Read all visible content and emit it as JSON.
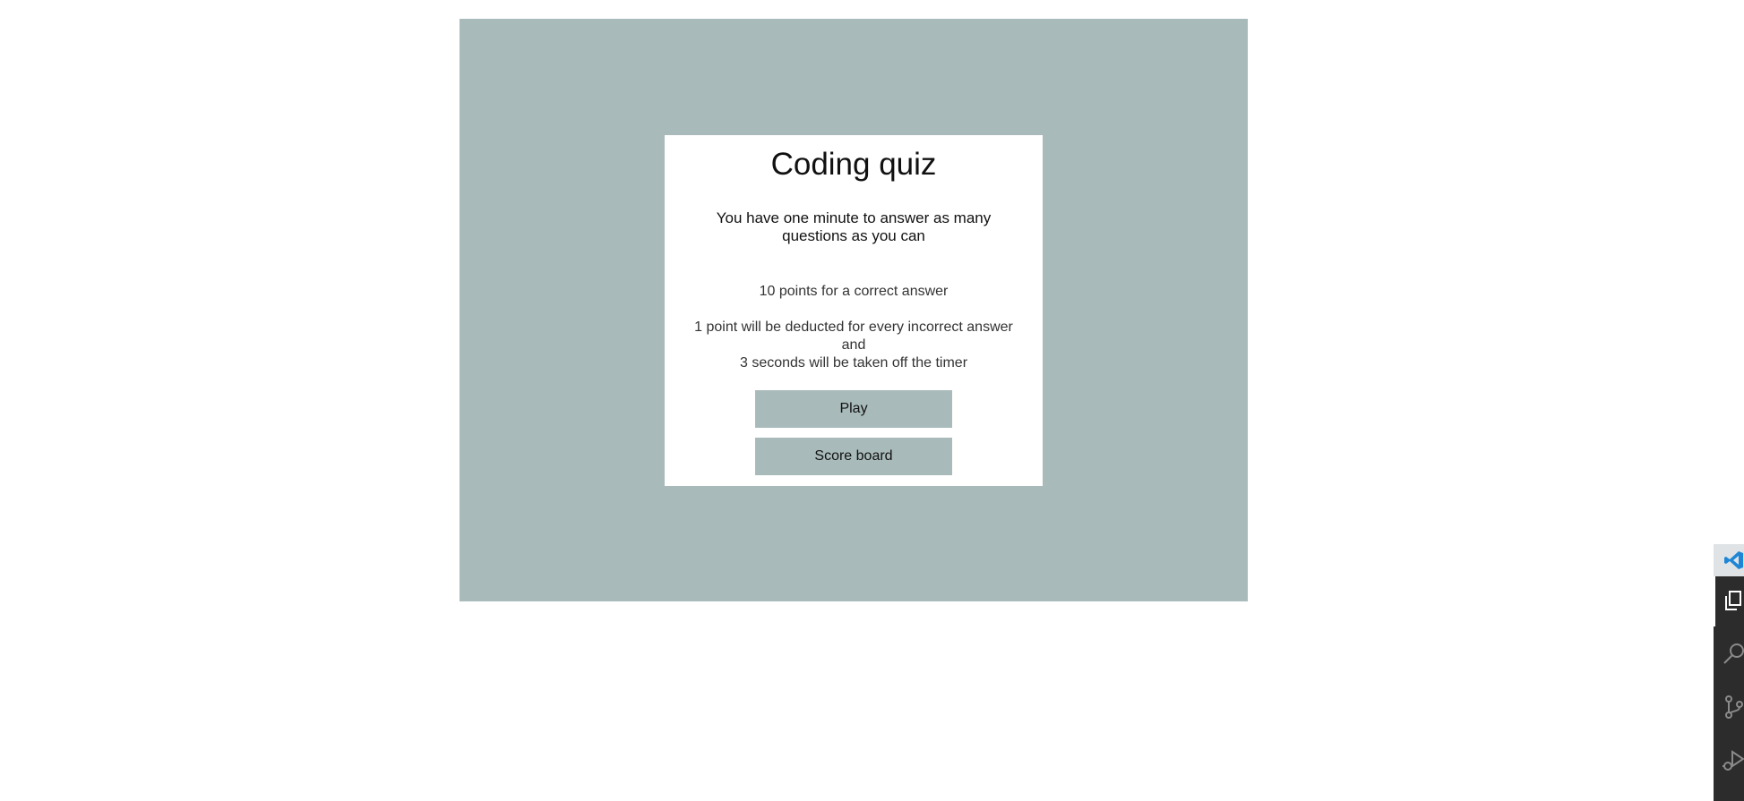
{
  "quiz": {
    "title": "Coding quiz",
    "intro": "You have one minute to answer as many questions as you can",
    "rule_points": "10 points for a correct answer",
    "rule_penalty_line1": "1 point will be deducted for every incorrect answer",
    "rule_penalty_line2": "and",
    "rule_penalty_line3": "3 seconds will be taken off the timer",
    "play_label": "Play",
    "scoreboard_label": "Score board"
  },
  "colors": {
    "stage_background": "#a8bbba",
    "card_background": "#ffffff",
    "button_background": "#a8bbba"
  },
  "vscode_activity_bar": {
    "icons": [
      "vscode-logo-icon",
      "explorer-icon",
      "search-icon",
      "source-control-icon",
      "run-debug-icon"
    ]
  }
}
